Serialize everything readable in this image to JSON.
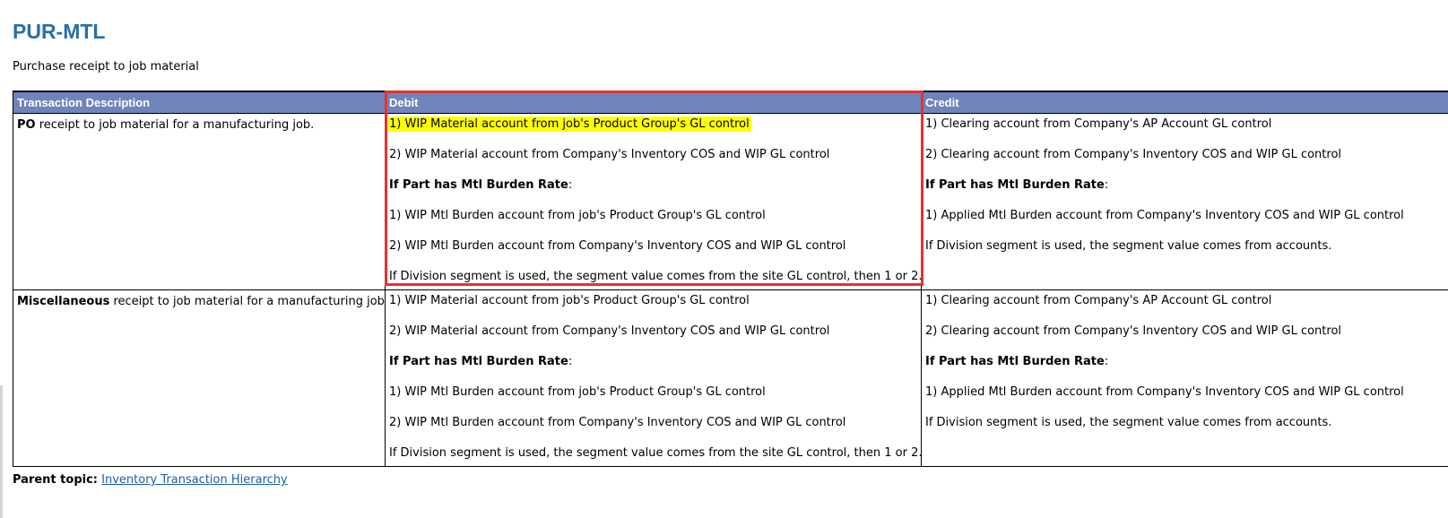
{
  "title": "PUR-MTL",
  "subtitle": "Purchase receipt to job material",
  "table": {
    "headers": [
      "Transaction Description",
      "Debit",
      "Credit"
    ],
    "rows": [
      {
        "desc_bold": "PO",
        "desc_rest": " receipt to job material for a manufacturing job.",
        "debit": [
          "1) WIP Material account from job's Product Group's GL control",
          "2) WIP Material account from Company's Inventory COS and WIP GL control",
          "If Part has Mtl Burden Rate",
          "1) WIP Mtl Burden account from job's Product Group's GL control",
          "2) WIP Mtl Burden account from Company's Inventory COS and WIP GL control",
          "If Division segment is used, the segment value comes from the site GL control, then 1 or 2."
        ],
        "credit": [
          "1) Clearing account from Company's AP Account GL control",
          "2) Clearing account from Company's Inventory COS and WIP GL control",
          "If Part has Mtl Burden Rate",
          "1) Applied Mtl Burden account from Company's Inventory COS and WIP GL control",
          "If Division segment is used, the segment value comes from accounts."
        ]
      },
      {
        "desc_bold": "Miscellaneous",
        "desc_rest": " receipt to job material for a manufacturing job.",
        "debit": [
          "1) WIP Material account from job's Product Group's GL control",
          "2) WIP Material account from Company's Inventory COS and WIP GL control",
          "If Part has Mtl Burden Rate",
          "1) WIP Mtl Burden account from job's Product Group's GL control",
          "2) WIP Mtl Burden account from Company's Inventory COS and WIP GL control",
          "If Division segment is used, the segment value comes from the site GL control, then 1 or 2."
        ],
        "credit": [
          "1) Clearing account from Company's AP Account GL control",
          "2) Clearing account from Company's Inventory COS and WIP GL control",
          "If Part has Mtl Burden Rate",
          "1) Applied Mtl Burden account from Company's Inventory COS and WIP GL control",
          "If Division segment is used, the segment value comes from accounts."
        ]
      }
    ]
  },
  "colon": ":",
  "parent_topic": {
    "label": "Parent topic:",
    "link": "Inventory Transaction Hierarchy"
  },
  "colors": {
    "title": "#2a6ea6",
    "header_bg": "#6f84bb",
    "highlight": "#ffff00",
    "annotation_box": "#e8312f",
    "link": "#1a5fa6"
  }
}
